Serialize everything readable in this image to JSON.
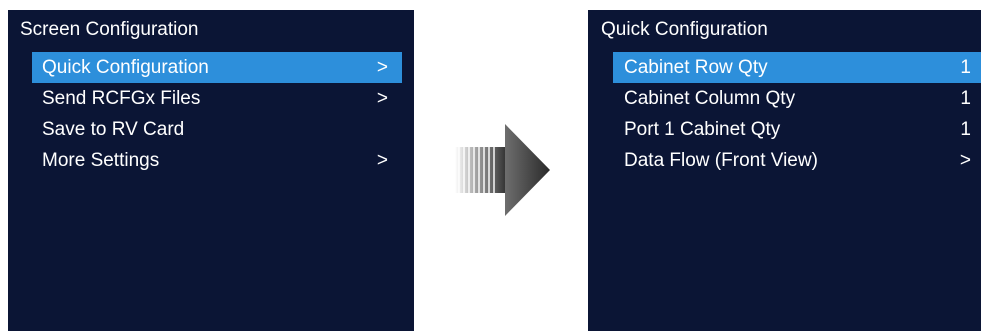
{
  "left_panel": {
    "title": "Screen Configuration",
    "items": [
      {
        "label": "Quick Configuration",
        "right": ">",
        "selected": true
      },
      {
        "label": "Send RCFGx Files",
        "right": ">",
        "selected": false
      },
      {
        "label": "Save to RV Card",
        "right": "",
        "selected": false
      },
      {
        "label": "More Settings",
        "right": ">",
        "selected": false
      }
    ]
  },
  "right_panel": {
    "title": "Quick Configuration",
    "items": [
      {
        "label": "Cabinet Row Qty",
        "right": "1",
        "selected": true
      },
      {
        "label": "Cabinet Column Qty",
        "right": "1",
        "selected": false
      },
      {
        "label": "Port 1 Cabinet Qty",
        "right": "1",
        "selected": false
      },
      {
        "label": "Data Flow (Front View)",
        "right": ">",
        "selected": false
      }
    ]
  },
  "colors": {
    "panel_background": "#0b1535",
    "selection_highlight": "#2d8fdb",
    "text": "#ffffff",
    "arrow_dark": "#3a3a3a"
  },
  "icons": {
    "transition": "right-arrow-icon"
  }
}
